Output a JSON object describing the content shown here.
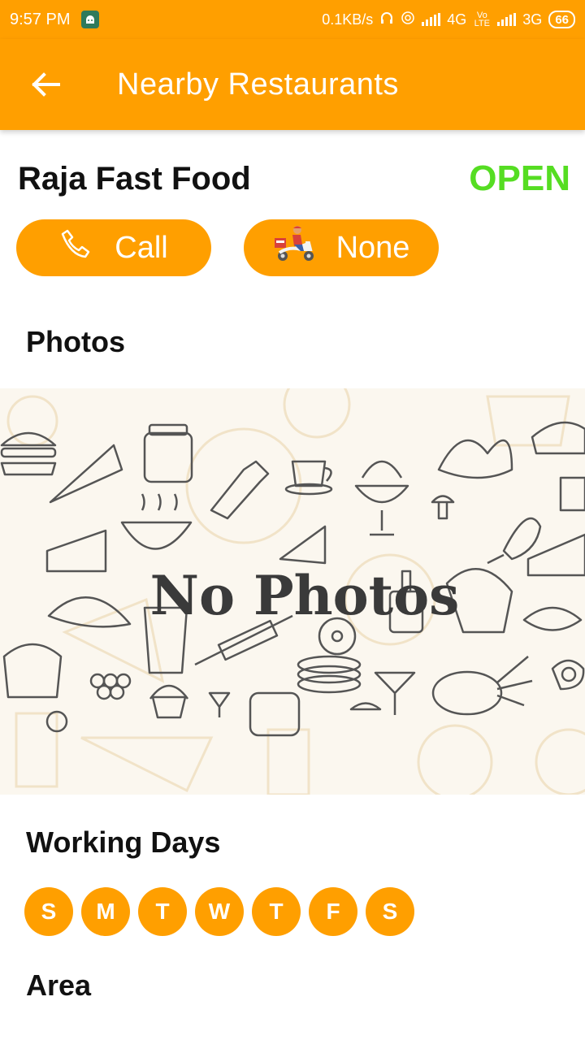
{
  "status_bar": {
    "time": "9:57 PM",
    "net_speed": "0.1KB/s",
    "network1": "4G",
    "volte": "Vo LTE",
    "network2": "3G",
    "battery": "66"
  },
  "app_bar": {
    "title": "Nearby Restaurants",
    "back_icon": "arrow-left-icon"
  },
  "restaurant": {
    "name": "Raja Fast Food",
    "status": "OPEN",
    "status_color": "#55dd22"
  },
  "actions": {
    "call_label": "Call",
    "call_icon": "phone-icon",
    "delivery_label": "None",
    "delivery_icon": "delivery-scooter-icon"
  },
  "photos": {
    "title": "Photos",
    "empty_text": "No Photos"
  },
  "working_days": {
    "title": "Working Days",
    "days": [
      "S",
      "M",
      "T",
      "W",
      "T",
      "F",
      "S"
    ]
  },
  "area": {
    "title": "Area"
  },
  "colors": {
    "accent": "#ff9f00",
    "open": "#55dd22"
  }
}
